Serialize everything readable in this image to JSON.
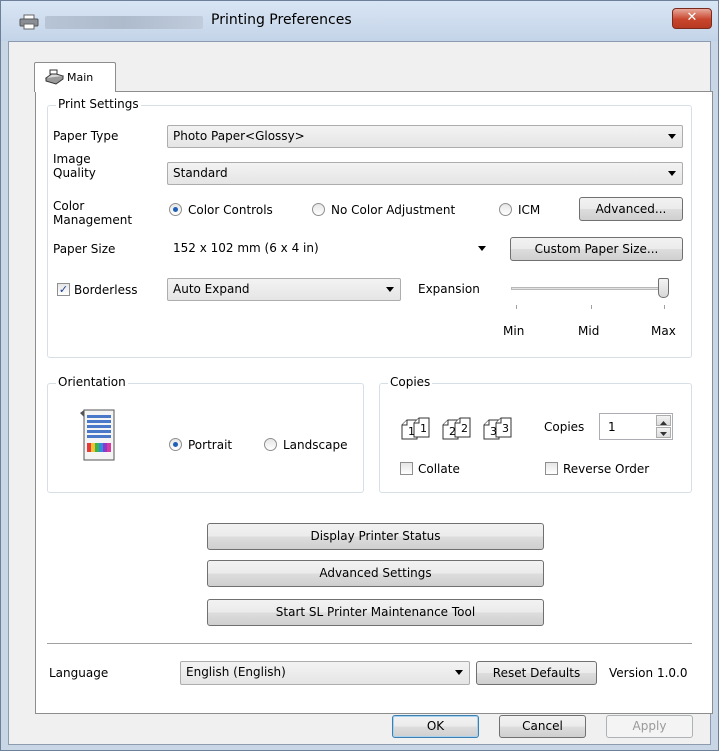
{
  "window": {
    "title": "Printing Preferences",
    "close_glyph": "✕"
  },
  "tab": {
    "label": "Main"
  },
  "print_settings": {
    "title": "Print Settings",
    "paper_type": {
      "label": "Paper Type",
      "value": "Photo Paper<Glossy>"
    },
    "image_quality": {
      "label_line1": "Image",
      "label_line2": "Quality",
      "value": "Standard"
    },
    "color_management": {
      "label_line1": "Color",
      "label_line2": "Management",
      "options": [
        "Color Controls",
        "No Color Adjustment",
        "ICM"
      ],
      "selected": "Color Controls",
      "advanced_label": "Advanced..."
    },
    "paper_size": {
      "label": "Paper Size",
      "value": "152 x 102 mm (6 x 4 in)",
      "custom_label": "Custom Paper Size..."
    },
    "borderless": {
      "label": "Borderless",
      "checked": true,
      "value": "Auto Expand"
    },
    "expansion": {
      "label": "Expansion",
      "min_label": "Min",
      "mid_label": "Mid",
      "max_label": "Max",
      "level": "Max"
    }
  },
  "orientation": {
    "title": "Orientation",
    "portrait_label": "Portrait",
    "landscape_label": "Landscape",
    "selected": "Portrait"
  },
  "copies": {
    "title": "Copies",
    "copies_label": "Copies",
    "copies_value": "1",
    "collate_label": "Collate",
    "reverse_label": "Reverse Order",
    "stack_labels": [
      "1",
      "1",
      "2",
      "2",
      "3",
      "3"
    ]
  },
  "actions": {
    "display_status": "Display Printer Status",
    "advanced_settings": "Advanced Settings",
    "maintenance": "Start SL Printer Maintenance Tool"
  },
  "language": {
    "label": "Language",
    "value": "English (English)",
    "reset_label": "Reset Defaults",
    "version": "Version 1.0.0"
  },
  "footer": {
    "ok": "OK",
    "cancel": "Cancel",
    "apply": "Apply"
  },
  "colors": {
    "title_bg": "#c9d6e6",
    "close_red": "#c7452c",
    "radio_dot": "#1e5fb8"
  }
}
